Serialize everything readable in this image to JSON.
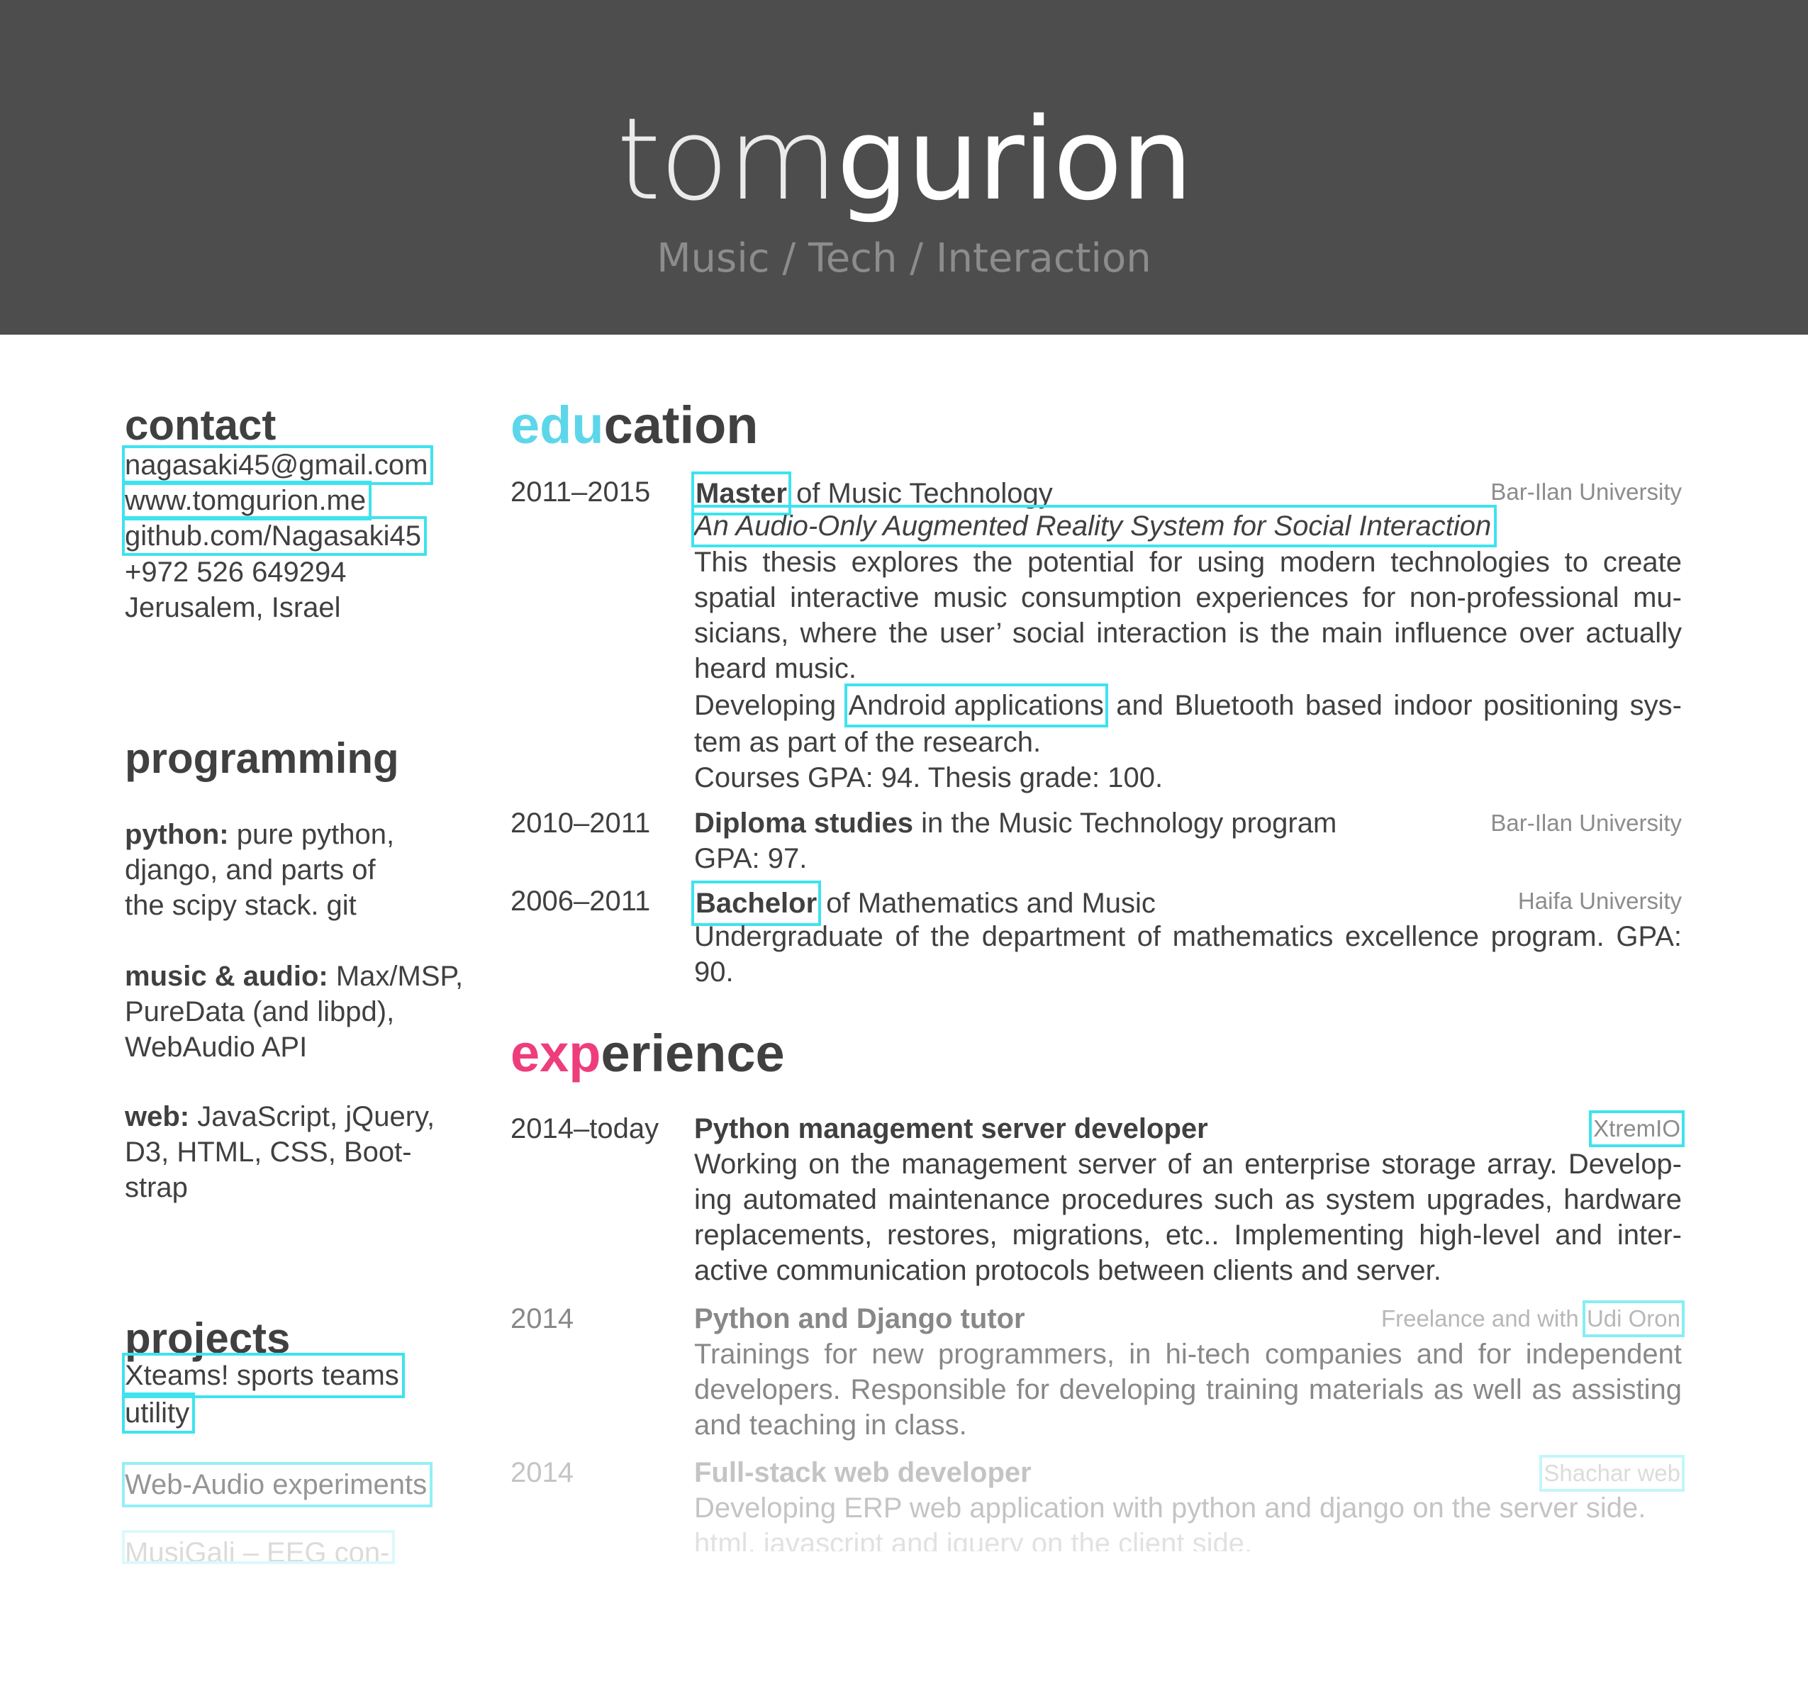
{
  "header": {
    "first_name": "tom",
    "last_name": "gurion",
    "tagline": "Music / Tech / Interaction"
  },
  "sidebar": {
    "contact": {
      "heading": "contact",
      "email": "nagasaki45@gmail.com",
      "website": "www.tomgurion.me",
      "github": "github.com/Nagasaki45",
      "phone": "+972 526 649294",
      "location": "Jerusalem, Israel"
    },
    "programming": {
      "heading": "programming",
      "python_label": "python:",
      "python_text_1": "pure python,",
      "python_text_2": "django, and parts of",
      "python_text_3": "the scipy stack. git",
      "music_label": "music & audio:",
      "music_text_1": "Max/MSP,",
      "music_text_2": "PureData (and libpd),",
      "music_text_3": "WebAudio API",
      "web_label": "web:",
      "web_text_1": "JavaScript, jQuery,",
      "web_text_2": "D3, HTML, CSS, Boot-",
      "web_text_3": "strap"
    },
    "projects": {
      "heading": "projects",
      "item1_line1": "Xteams! sports teams",
      "item1_line2": "utility",
      "item2": "Web-Audio experiments",
      "item3": "MusiGali – EEG con-"
    }
  },
  "education": {
    "heading_accent": "edu",
    "heading_rest": "cation",
    "accent_color": "#5dd6ea",
    "entries": [
      {
        "date": "2011–2015",
        "degree": "Master",
        "degree_rest": "of Music Technology",
        "institution": "Bar-Ilan University",
        "thesis_title": "An Audio-Only Augmented Reality System for Social Interaction",
        "desc_1": "This thesis explores the potential for using modern technologies to create",
        "desc_2": "spatial interactive music consumption experiences for non-professional mu-",
        "desc_3": "sicians, where the user’ social interaction is the main influence over actually",
        "desc_4": "heard music.",
        "dev_pre": "Developing",
        "dev_link": "Android applications",
        "dev_post": "and Bluetooth based indoor positioning sys-",
        "dev_2": "tem as part of the research.",
        "grades": "Courses GPA: 94.  Thesis grade: 100."
      },
      {
        "date": "2010–2011",
        "degree": "Diploma studies",
        "degree_rest": "in the Music Technology program",
        "institution": "Bar-Ilan University",
        "gpa": "GPA: 97."
      },
      {
        "date": "2006–2011",
        "degree": "Bachelor",
        "degree_rest": "of Mathematics and Music",
        "institution": "Haifa University",
        "desc_1": "Undergraduate of the department of mathematics excellence program.  GPA:",
        "desc_2": "90."
      }
    ]
  },
  "experience": {
    "heading_accent": "exp",
    "heading_rest": "erience",
    "accent_color": "#ee3d7c",
    "entries": [
      {
        "date": "2014–today",
        "title": "Python management server developer",
        "company": "XtremIO",
        "desc_1": "Working on the management server of an enterprise storage array.  Develop-",
        "desc_2": "ing automated maintenance procedures such as system upgrades, hardware",
        "desc_3": "replacements, restores, migrations, etc..  Implementing high-level and inter-",
        "desc_4": "active communication protocols between clients and server."
      },
      {
        "date": "2014",
        "title": "Python and Django tutor",
        "company_pre": "Freelance and with",
        "company": "Udi Oron",
        "desc_1": "Trainings for new programmers, in hi-tech companies and for independent",
        "desc_2": "developers.  Responsible for developing training materials as well as assisting",
        "desc_3": "and teaching in class."
      },
      {
        "date": "2014",
        "title": "Full-stack web developer",
        "company": "Shachar web",
        "desc_1": "Developing ERP web application with python and django on the server side.",
        "desc_2": "html, javascript and jquery on the client side."
      }
    ]
  }
}
